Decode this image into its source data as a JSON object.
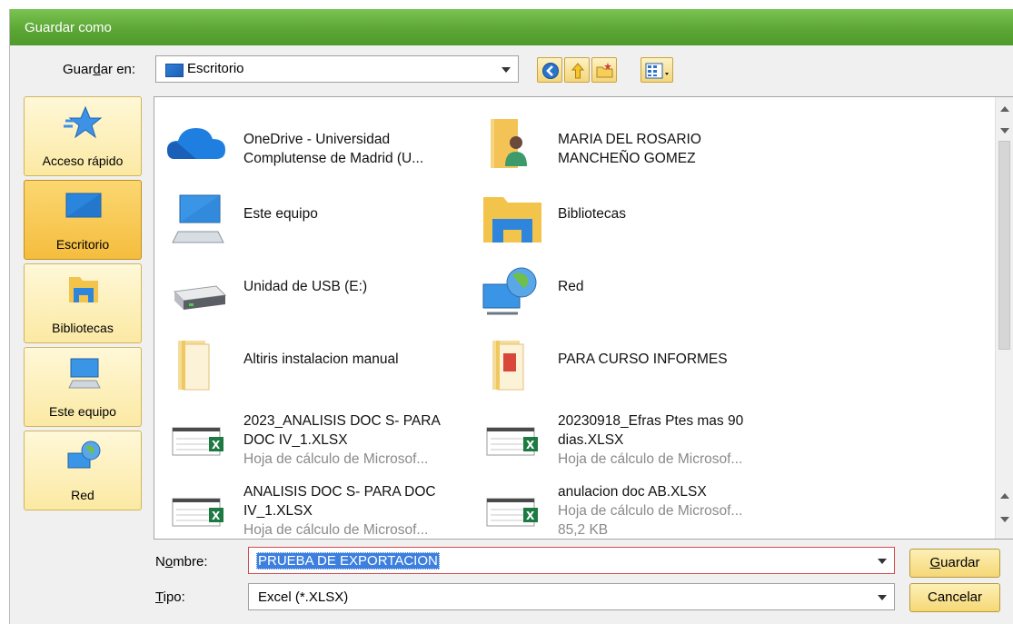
{
  "dialog": {
    "title": "Guardar como",
    "save_in": {
      "label_pre": "Guar",
      "label_key": "d",
      "label_post": "ar en:",
      "value": "Escritorio"
    },
    "places": [
      {
        "label": "Acceso rápido",
        "icon": "star-icon"
      },
      {
        "label": "Escritorio",
        "icon": "desktop-icon",
        "selected": true
      },
      {
        "label": "Bibliotecas",
        "icon": "libraries-folder-icon"
      },
      {
        "label": "Este equipo",
        "icon": "computer-icon"
      },
      {
        "label": "Red",
        "icon": "network-globe-icon"
      }
    ],
    "files": [
      {
        "name": "OneDrive - Universidad Complutense de Madrid (U...",
        "icon": "onedrive-cloud-icon"
      },
      {
        "name": "MARIA DEL ROSARIO MANCHEÑO GOMEZ",
        "icon": "user-folder-icon"
      },
      {
        "name": "Este equipo",
        "icon": "computer-icon"
      },
      {
        "name": "Bibliotecas",
        "icon": "libraries-folder-icon"
      },
      {
        "name": "Unidad de USB (E:)",
        "icon": "usb-drive-icon"
      },
      {
        "name": "Red",
        "icon": "network-globe-icon"
      },
      {
        "name": "Altiris instalacion manual",
        "icon": "folder-icon"
      },
      {
        "name": "PARA CURSO INFORMES",
        "icon": "folder-icon"
      },
      {
        "name": "2023_ANALISIS DOC S- PARA DOC IV_1.XLSX",
        "type": "Hoja de cálculo de Microsof...",
        "icon": "excel-file-icon"
      },
      {
        "name": "20230918_Efras Ptes mas 90 dias.XLSX",
        "type": "Hoja de cálculo de Microsof...",
        "icon": "excel-file-icon"
      },
      {
        "name": "ANALISIS DOC S- PARA DOC IV_1.XLSX",
        "type": "Hoja de cálculo de Microsof...",
        "icon": "excel-file-icon"
      },
      {
        "name": "anulacion doc AB.XLSX",
        "type": "Hoja de cálculo de Microsof...",
        "size": "85,2 KB",
        "icon": "excel-file-icon"
      }
    ],
    "filename": {
      "label_pre": "N",
      "label_key": "o",
      "label_post": "mbre:",
      "value": "PRUEBA DE EXPORTACION"
    },
    "filetype": {
      "label_key": "T",
      "label_post": "ipo:",
      "value": "Excel (*.XLSX)"
    },
    "buttons": {
      "save_key": "G",
      "save_rest": "uardar",
      "cancel": "Cancelar"
    },
    "colors": {
      "title_green": "#5aa533",
      "selection_blue": "#3c7fde",
      "place_selected": "#f5bd3e"
    }
  }
}
